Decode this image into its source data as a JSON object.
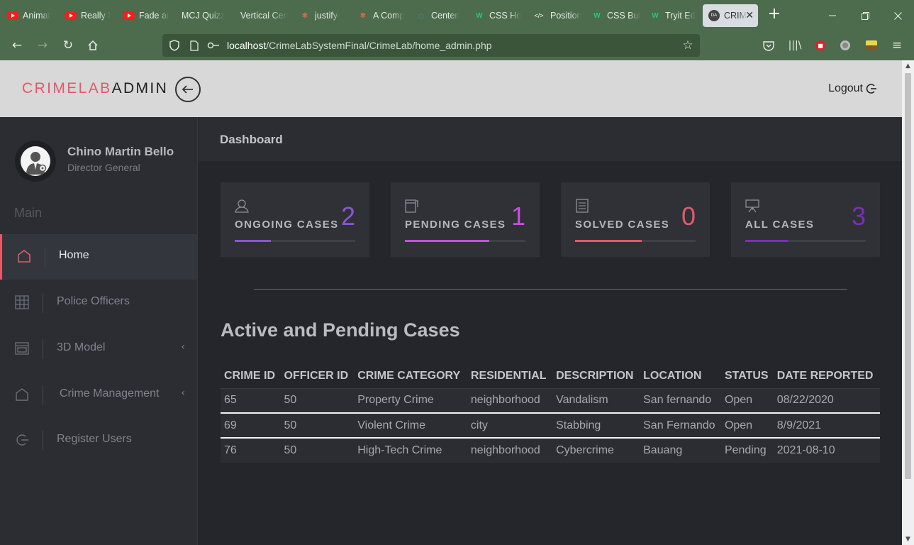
{
  "browser": {
    "tabs": [
      {
        "label": "Animat",
        "icon": "youtube-icon",
        "active": false
      },
      {
        "label": "Really f",
        "icon": "youtube-icon",
        "active": false
      },
      {
        "label": "Fade ar",
        "icon": "youtube-icon",
        "active": false
      },
      {
        "label": "MCJ Quizz",
        "icon": "none",
        "active": false
      },
      {
        "label": "Vertical Cen",
        "icon": "none",
        "active": false
      },
      {
        "label": "justify-",
        "icon": "asterisk-icon",
        "active": false
      },
      {
        "label": "A Comp",
        "icon": "asterisk-icon",
        "active": false
      },
      {
        "label": "Centeri",
        "icon": "circle-logo-icon",
        "active": false
      },
      {
        "label": "CSS Ho",
        "icon": "w-logo-icon",
        "active": false
      },
      {
        "label": "Position",
        "icon": "code-icon",
        "active": false
      },
      {
        "label": "CSS But",
        "icon": "w-logo-icon",
        "active": false
      },
      {
        "label": "Tryit Ed",
        "icon": "w-logo-icon",
        "active": false
      },
      {
        "label": "CRIM",
        "icon": "da-icon",
        "favicon_text": "DA",
        "active": true
      }
    ],
    "url_host": "localhost",
    "url_path": "/CrimeLabSystemFinal/CrimeLab/home_admin.php",
    "close_glyph": "✕",
    "new_tab_glyph": "+"
  },
  "header": {
    "brand_part1": "CRIMELAB",
    "brand_part2": "ADMIN",
    "logout_label": "Logout"
  },
  "sidebar": {
    "user_name": "Chino Martin Bello",
    "user_role": "Director General",
    "section_label": "Main",
    "items": [
      {
        "label": "Home",
        "icon": "home-icon",
        "active": true,
        "has_submenu": false
      },
      {
        "label": "Police Officers",
        "icon": "grid-icon",
        "active": false,
        "has_submenu": false
      },
      {
        "label": "3D Model",
        "icon": "window-icon",
        "active": false,
        "has_submenu": true
      },
      {
        "label": "Crime Management",
        "icon": "home-outline-icon",
        "active": false,
        "has_submenu": true
      },
      {
        "label": "Register Users",
        "icon": "logout-circle-icon",
        "active": false,
        "has_submenu": false
      }
    ]
  },
  "main": {
    "title": "Dashboard",
    "cards": [
      {
        "label": "ONGOING CASES",
        "value": "2",
        "icon": "user-icon",
        "color": "#8b55d6",
        "progress": 0.3
      },
      {
        "label": "PENDING CASES",
        "value": "1",
        "icon": "notebook-icon",
        "color": "#c94ee0",
        "progress": 0.7
      },
      {
        "label": "SOLVED CASES",
        "value": "0",
        "icon": "document-icon",
        "color": "#e2596b",
        "progress": 0.55
      },
      {
        "label": "ALL CASES",
        "value": "3",
        "icon": "presentation-icon",
        "color": "#7b2fb5",
        "progress": 0.35
      }
    ],
    "table_title": "Active and Pending Cases",
    "table": {
      "headers": [
        "CRIME ID",
        "OFFICER ID",
        "CRIME CATEGORY",
        "RESIDENTIAL",
        "DESCRIPTION",
        "LOCATION",
        "STATUS",
        "DATE REPORTED"
      ],
      "rows": [
        [
          "65",
          "50",
          "Property Crime",
          "neighborhood",
          "Vandalism",
          "San fernando",
          "Open",
          "08/22/2020"
        ],
        [
          "69",
          "50",
          "Violent Crime",
          "city",
          "Stabbing",
          "San Fernando",
          "Open",
          "8/9/2021"
        ],
        [
          "76",
          "50",
          "High-Tech Crime",
          "neighborhood",
          "Cybercrime",
          "Bauang",
          "Pending",
          "2021-08-10"
        ]
      ]
    }
  }
}
